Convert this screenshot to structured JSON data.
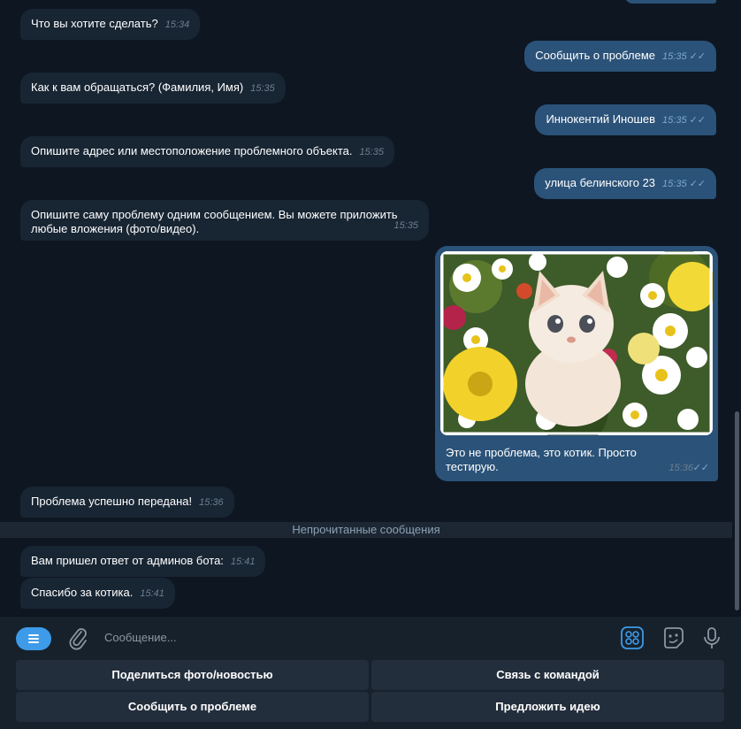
{
  "messages": [
    {
      "text": "Что вы хотите сделать?",
      "time": "15:34"
    },
    {
      "text": "Сообщить о проблеме",
      "time": "15:35"
    },
    {
      "text": "Как к вам обращаться? (Фамилия, Имя)",
      "time": "15:35"
    },
    {
      "text": "Иннокентий Иношев",
      "time": "15:35"
    },
    {
      "text": "Опишите адрес или местоположение проблемного объекта.",
      "time": "15:35"
    },
    {
      "text": "улица белинского 23",
      "time": "15:35"
    },
    {
      "text": "Опишите саму проблему одним сообщением. Вы можете приложить любые вложения (фото/видео).",
      "time": "15:35"
    },
    {
      "text": "Это не проблема, это котик. Просто тестирую.",
      "time": "15:36"
    },
    {
      "text": "Проблема успешно передана!",
      "time": "15:36"
    },
    {
      "text": "Вам пришел ответ от админов бота:",
      "time": "15:41"
    },
    {
      "text": "Спасибо за котика.",
      "time": "15:41"
    }
  ],
  "unread_label": "Непрочитанные сообщения",
  "composer": {
    "placeholder": "Сообщение...",
    "icons": [
      "menu-icon",
      "paperclip-icon",
      "bot-commands-icon",
      "sticker-icon",
      "microphone-icon"
    ]
  },
  "keyboard": {
    "buttons": [
      "Поделиться фото/новостью",
      "Связь с командой",
      "Сообщить о проблеме",
      "Предложить идею"
    ]
  },
  "colors": {
    "accent": "#3d9be9",
    "outgoing": "#2b5278",
    "incoming": "#182533",
    "background": "#0e1621"
  }
}
